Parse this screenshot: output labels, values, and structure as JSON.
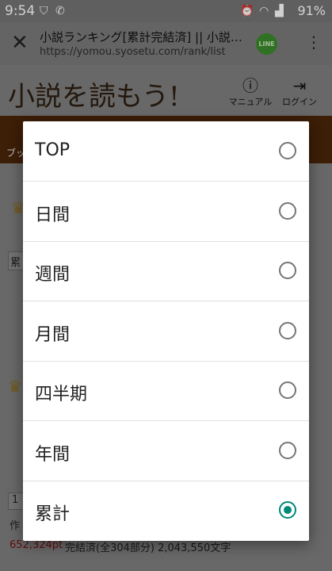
{
  "status_bar": {
    "time": "9:54",
    "battery": "91%"
  },
  "browser": {
    "close_symbol": "✕",
    "title": "小説ランキング[累計完結済] || 小説…",
    "url": "https://yomou.syosetu.com/rank/list",
    "line_label": "LINE",
    "more_symbol": "⋮"
  },
  "site_header": {
    "logo": "小説を読もう!",
    "manual_label": "マニュアル",
    "login_label": "ログイン"
  },
  "background": {
    "nav_text": "ブッ",
    "filter_text": "累",
    "rank_number": "1",
    "author_prefix": "作",
    "points": "652,324pt",
    "meta": "完結済(全304部分)  2,043,550文字"
  },
  "dialog": {
    "options": [
      {
        "label": "TOP",
        "selected": false
      },
      {
        "label": "日間",
        "selected": false
      },
      {
        "label": "週間",
        "selected": false
      },
      {
        "label": "月間",
        "selected": false
      },
      {
        "label": "四半期",
        "selected": false
      },
      {
        "label": "年間",
        "selected": false
      },
      {
        "label": "累計",
        "selected": true
      }
    ]
  },
  "colors": {
    "accent": "#00897b",
    "nav_brown": "#4b2509",
    "points_red": "#b71c1c"
  }
}
